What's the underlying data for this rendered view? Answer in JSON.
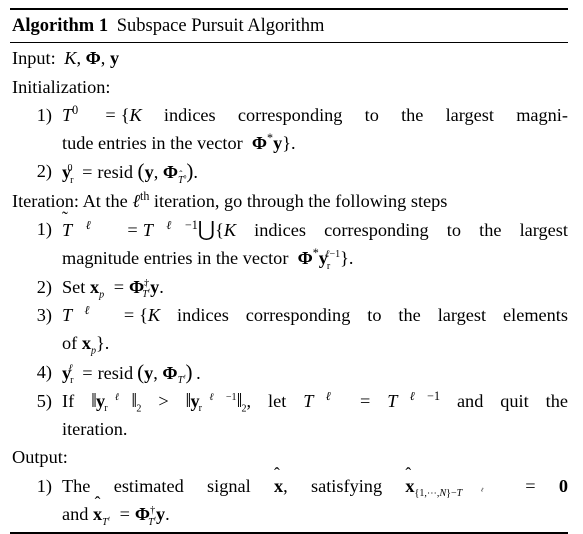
{
  "document": {
    "type": "algorithm-pseudocode-block",
    "title_label": "Algorithm 1",
    "title_text": "Subspace Pursuit Algorithm",
    "rules": {
      "top": "thick",
      "under_title": "thin",
      "bottom": "thick"
    }
  },
  "input": {
    "label": "Input:",
    "symbols": "K, Φ, y"
  },
  "initialization": {
    "label": "Initialization:",
    "items": [
      {
        "number": "1)",
        "text": "T⁰ = {K indices corresponding to the largest magnitude entries in the vector Φ*y}.",
        "line1": "T⁰ = {K  indices corresponding to the largest magni-",
        "line2": "tude entries in the vector Φ*y}."
      },
      {
        "number": "2)",
        "text": "yʳ⁰ = resid (y, Φ_{T̂⁰})."
      }
    ]
  },
  "iteration": {
    "label": "Iteration:",
    "intro": "At the ℓth iteration, go through the following steps",
    "items": [
      {
        "number": "1)",
        "text": "T̃^ℓ = T^{ℓ−1} ⋃ {K indices corresponding to the largest magnitude entries in the vector Φ*y_r^{ℓ−1}}.",
        "line1": "T̃^ℓ = T^{ℓ−1}⋃{K  indices corresponding to the largest",
        "line2": "magnitude entries in the vector Φ*y_r^{ℓ−1}}."
      },
      {
        "number": "2)",
        "text": "Set x_p = Φ†_{T̃^ℓ} y."
      },
      {
        "number": "3)",
        "text": "T^ℓ = {K indices corresponding to the largest elements of x_p}.",
        "line1": "T^ℓ = {K  indices corresponding to the largest elements",
        "line2": "of x_p}."
      },
      {
        "number": "4)",
        "text": "y_r^ℓ = resid (y, Φ_{T^ℓ})."
      },
      {
        "number": "5)",
        "text": "If ‖y_r^ℓ‖₂ > ‖y_r^{ℓ−1}‖₂, let T^ℓ = T^{ℓ−1} and quit the iteration.",
        "line1": "If ‖y_r^ℓ‖₂ > ‖y_r^{ℓ−1}‖₂, let T^ℓ = T^{ℓ−1} and quit the",
        "line2": "iteration."
      }
    ]
  },
  "output": {
    "label": "Output:",
    "items": [
      {
        "number": "1)",
        "text": "The estimated signal x̂, satisfying x̂_{{1,⋯,N}−T^ℓ} = 0 and x̂_{T^ℓ} = Φ†_{T^ℓ} y.",
        "line1": "The estimated signal x̂, satisfying x̂_{{1,⋯,N}−T^ℓ} = 0",
        "line2": "and x̂_{T^ℓ} = Φ†_{T^ℓ} y."
      }
    ]
  },
  "symbols": {
    "K": "K",
    "Phi": "Φ",
    "y": "y",
    "x": "x",
    "T": "T",
    "ell": "ℓ",
    "dagger": "†",
    "star": "*",
    "union": "⋃",
    "equals": "=",
    "greater_than": ">",
    "zero": "0",
    "two": "2",
    "one": "1",
    "N": "N",
    "resid": "resid",
    "ldots": "⋯",
    "norm_bar": "‖",
    "hat": "ˆ",
    "tilde": "˜",
    "minus": "−",
    "th_suffix": "th",
    "subscript_p": "p",
    "subscript_r": "r"
  },
  "colors": {
    "text": "#000000",
    "background": "#ffffff",
    "rule": "#000000"
  }
}
